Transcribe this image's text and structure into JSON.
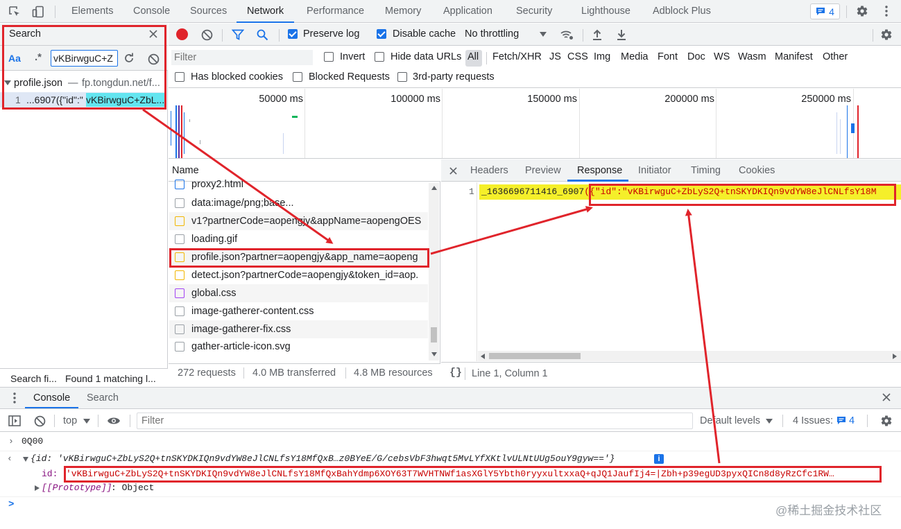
{
  "tabs": [
    "Elements",
    "Console",
    "Sources",
    "Network",
    "Performance",
    "Memory",
    "Application",
    "Security",
    "Lighthouse",
    "Adblock Plus"
  ],
  "issues_badge": "4",
  "search": {
    "title": "Search",
    "aa": "Aa",
    "regex": ".*",
    "query": "vKBirwguC+Z",
    "file": "profile.json",
    "file_host": "fp.tongdun.net/f...",
    "match_line": "1",
    "match_pre": "...6907({\"id\":\"",
    "match_hl": "vKBirwguC+ZbL...",
    "footer_left": "Search fi...",
    "footer_right": "Found 1 matching l..."
  },
  "toolbar": {
    "preserve_log": "Preserve log",
    "disable_cache": "Disable cache",
    "throttle": "No throttling"
  },
  "filter": {
    "placeholder": "Filter",
    "invert": "Invert",
    "hide_data_urls": "Hide data URLs",
    "types": [
      "All",
      "Fetch/XHR",
      "JS",
      "CSS",
      "Img",
      "Media",
      "Font",
      "Doc",
      "WS",
      "Wasm",
      "Manifest",
      "Other"
    ],
    "has_blocked": "Has blocked cookies",
    "blocked_requests": "Blocked Requests",
    "third_party": "3rd-party requests"
  },
  "timeline": [
    "50000 ms",
    "100000 ms",
    "150000 ms",
    "200000 ms",
    "250000 ms"
  ],
  "list": {
    "header": "Name",
    "rows": [
      "proxy2.html",
      "data:image/png;base...",
      "v1?partnerCode=aopengjy&appName=aopengOES",
      "loading.gif",
      "profile.json?partner=aopengjy&app_name=aopeng",
      "detect.json?partnerCode=aopengjy&token_id=aop.",
      "global.css",
      "image-gatherer-content.css",
      "image-gatherer-fix.css",
      "gather-article-icon.svg"
    ]
  },
  "status": {
    "requests": "272 requests",
    "transferred": "4.0 MB transferred",
    "resources": "4.8 MB resources"
  },
  "detail": {
    "tabs": [
      "Headers",
      "Preview",
      "Response",
      "Initiator",
      "Timing",
      "Cookies"
    ],
    "line_no": "1",
    "line_pre": "_1636696711416_6907",
    "line_hl": "({\"id\":\"vKBirwguC+ZbLyS2Q+tnSKYDKIQn9vdYW8eJlCNLfsY18M",
    "position": "Line 1, Column 1"
  },
  "drawer": {
    "tabs": [
      "Console",
      "Search"
    ],
    "context": "top",
    "filter_placeholder": "Filter",
    "levels": "Default levels",
    "issues": "4 Issues:",
    "issues_count": "4"
  },
  "console": {
    "line1": "0Q00",
    "obj_summary": "{id: 'vKBirwguC+ZbLyS2Q+tnSKYDKIQn9vdYW8eJlCNLfsY18MfQxB…z0BYeE/G/cebsVbF3hwqt5MvLYfXKtlvULNtUUg5ouY9gyw=='}",
    "id_key": "id:",
    "id_value": "'vKBirwguC+ZbLyS2Q+tnSKYDKIQn9vdYW8eJlCNLfsY18MfQxBahYdmp6XOY63T7WVHTNWf1asXGlY5Ybth0ryyxultxxaQ+qJQ1JaufIj4=|Zbh+p39egUD3pyxQICn8d8yRzCfc1RW…",
    "proto": "[[Prototype]]",
    "proto_val": ": Object",
    "prompt": ">"
  },
  "watermark": "@稀土掘金技术社区",
  "colors": {
    "accent": "#1a73e8",
    "annotation": "#e0242b",
    "highlight": "#63e5f0",
    "resp_highlight": "#f5ef2a"
  }
}
